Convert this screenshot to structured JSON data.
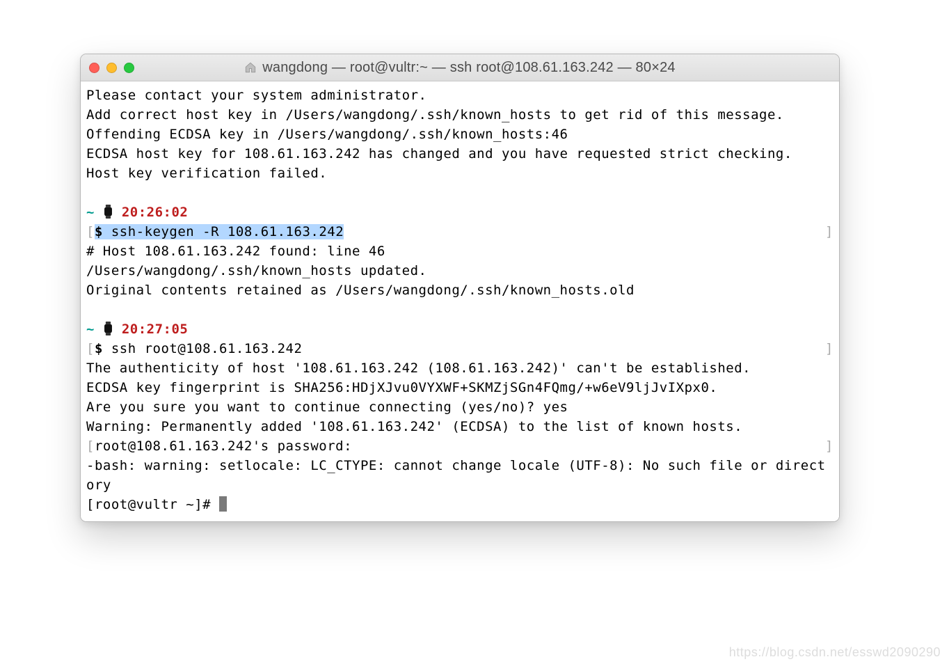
{
  "window": {
    "title": "wangdong — root@vultr:~ — ssh root@108.61.163.242 — 80×24"
  },
  "pre": {
    "l1": "Please contact your system administrator.",
    "l2": "Add correct host key in /Users/wangdong/.ssh/known_hosts to get rid of this message.",
    "l3": "Offending ECDSA key in /Users/wangdong/.ssh/known_hosts:46",
    "l4": "ECDSA host key for 108.61.163.242 has changed and you have requested strict checking.",
    "l5": "Host key verification failed."
  },
  "p1": {
    "tilde": "~",
    "time": "20:26:02",
    "prompt": "$ ",
    "cmd": "ssh-keygen -R 108.61.163.242",
    "o1": "# Host 108.61.163.242 found: line 46",
    "o2": "/Users/wangdong/.ssh/known_hosts updated.",
    "o3": "Original contents retained as /Users/wangdong/.ssh/known_hosts.old"
  },
  "p2": {
    "tilde": "~",
    "time": "20:27:05",
    "prompt": "$ ",
    "cmd": "ssh root@108.61.163.242",
    "o1": "The authenticity of host '108.61.163.242 (108.61.163.242)' can't be established.",
    "o2": "ECDSA key fingerprint is SHA256:HDjXJvu0VYXWF+SKMZjSGn4FQmg/+w6eV9ljJvIXpx0.",
    "o3": "Are you sure you want to continue connecting (yes/no)? yes",
    "o4": "Warning: Permanently added '108.61.163.242' (ECDSA) to the list of known hosts.",
    "o5": "root@108.61.163.242's password:",
    "o6": "-bash: warning: setlocale: LC_CTYPE: cannot change locale (UTF-8): No such file or directory",
    "o7": "[root@vultr ~]# "
  },
  "watermark": "https://blog.csdn.net/esswd2090290"
}
